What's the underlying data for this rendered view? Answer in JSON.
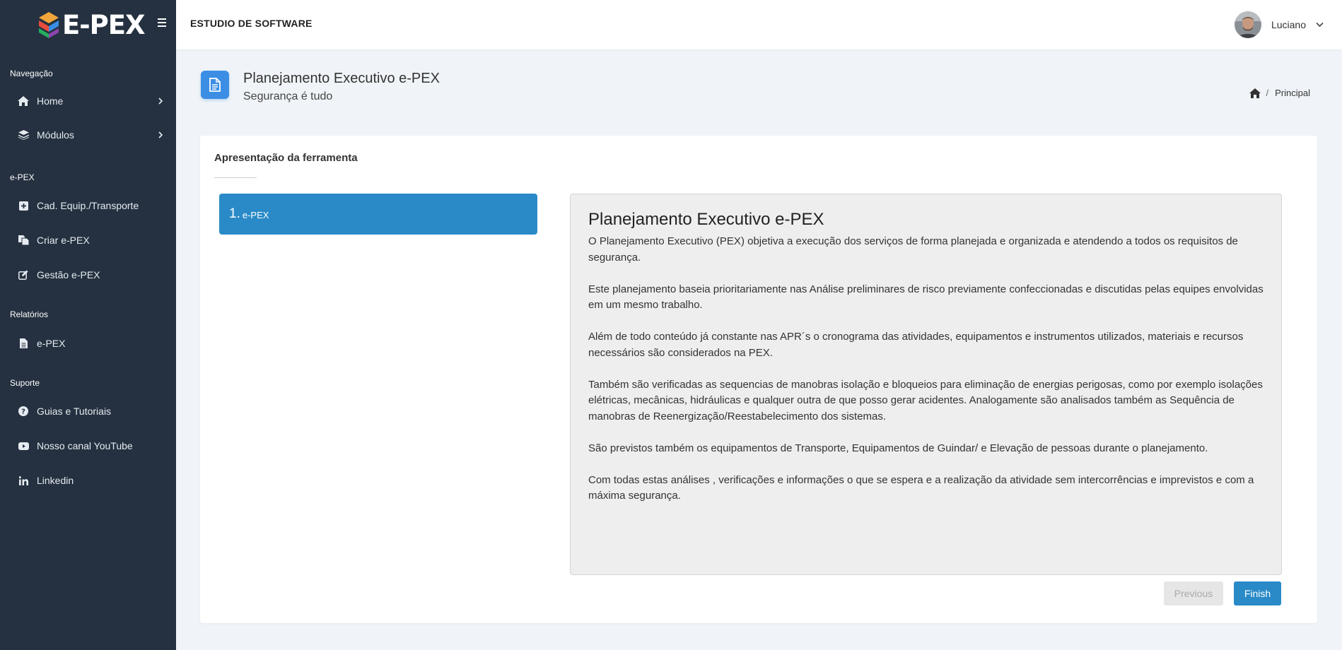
{
  "brand": {
    "name": "E-PEX"
  },
  "sidebar": {
    "sections": [
      {
        "label": "Navegação"
      },
      {
        "label": "e-PEX"
      },
      {
        "label": "Relatórios"
      },
      {
        "label": "Suporte"
      }
    ],
    "items": [
      {
        "label": "Home",
        "icon": "home-icon"
      },
      {
        "label": "Módulos",
        "icon": "layers-icon"
      },
      {
        "label": "Cad. Equip./Transporte",
        "icon": "plus-square-icon"
      },
      {
        "label": "Criar e-PEX",
        "icon": "copy-file-icon"
      },
      {
        "label": "Gestão e-PEX",
        "icon": "edit-icon"
      },
      {
        "label": "e-PEX",
        "icon": "file-icon"
      },
      {
        "label": "Guias e Tutoriais",
        "icon": "question-circle-icon"
      },
      {
        "label": "Nosso canal YouTube",
        "icon": "youtube-icon"
      },
      {
        "label": "Linkedin",
        "icon": "linkedin-icon"
      }
    ]
  },
  "topbar": {
    "company": "ESTUDIO DE SOFTWARE",
    "user": "Luciano"
  },
  "page": {
    "title": "Planejamento Executivo e-PEX",
    "subtitle": "Segurança é tudo",
    "breadcrumb": {
      "separator": "/",
      "current": "Principal"
    }
  },
  "card": {
    "title": "Apresentação da ferramenta",
    "steps": [
      {
        "number": "1.",
        "label": "e-PEX"
      }
    ],
    "content": {
      "title": "Planejamento Executivo e-PEX",
      "paragraphs": [
        "O Planejamento Executivo (PEX) objetiva a execução dos serviços de forma planejada e organizada e atendendo a todos os requisitos de segurança.",
        "Este planejamento baseia prioritariamente nas Análise preliminares de risco previamente confeccionadas e discutidas pelas equipes envolvidas em um mesmo trabalho.",
        "Além de todo conteúdo já constante nas APR´s o cronograma das atividades, equipamentos e instrumentos utilizados, materiais e recursos necessários são considerados na PEX.",
        "Também são verificadas as sequencias de manobras isolação e bloqueios para eliminação de energias perigosas, como por exemplo isolações elétricas, mecânicas, hidráulicas e qualquer outra de que posso gerar acidentes. Analogamente são analisados também as Sequência de manobras de Reenergização/Reestabelecimento dos sistemas.",
        "São previstos também os equipamentos de Transporte, Equipamentos de Guindar/ e Elevação de pessoas durante o planejamento.",
        "Com todas estas análises , verificações e informações o que se espera e a realização da atividade sem intercorrências e imprevistos e com a máxima segurança."
      ]
    },
    "buttons": {
      "previous": "Previous",
      "finish": "Finish"
    }
  },
  "colors": {
    "sidebar": "#253140",
    "accent": "#2a8ac8",
    "page_icon": "#3b8ee4"
  }
}
